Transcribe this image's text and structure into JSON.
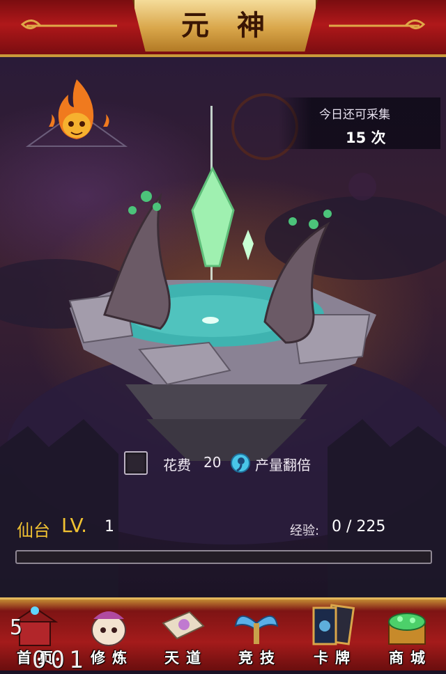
{
  "header": {
    "title": "元神"
  },
  "collect": {
    "label": "今日还可采集",
    "count": "15 次"
  },
  "double_output": {
    "cost_label": "花费",
    "cost_amount": "20",
    "label": "产量翻倍",
    "checked": false
  },
  "level": {
    "label": "仙台",
    "lv_text": "LV.",
    "value": "1"
  },
  "experience": {
    "label": "经验:",
    "value": "0 / 225",
    "progress": 0
  },
  "nav": {
    "items": [
      {
        "label": "首页",
        "icon": "home-icon"
      },
      {
        "label": "修炼",
        "icon": "cultivate-icon"
      },
      {
        "label": "天道",
        "icon": "heaven-path-icon"
      },
      {
        "label": "竞技",
        "icon": "arena-icon"
      },
      {
        "label": "卡牌",
        "icon": "cards-icon"
      },
      {
        "label": "商城",
        "icon": "shop-icon"
      }
    ],
    "overlay_digit": "5",
    "overlay_digits": "001"
  },
  "colors": {
    "accent_gold": "#f1c232",
    "pool_water": "#3fb3b0",
    "crystal": "#9ff0b0",
    "header_red": "#b0181a"
  }
}
